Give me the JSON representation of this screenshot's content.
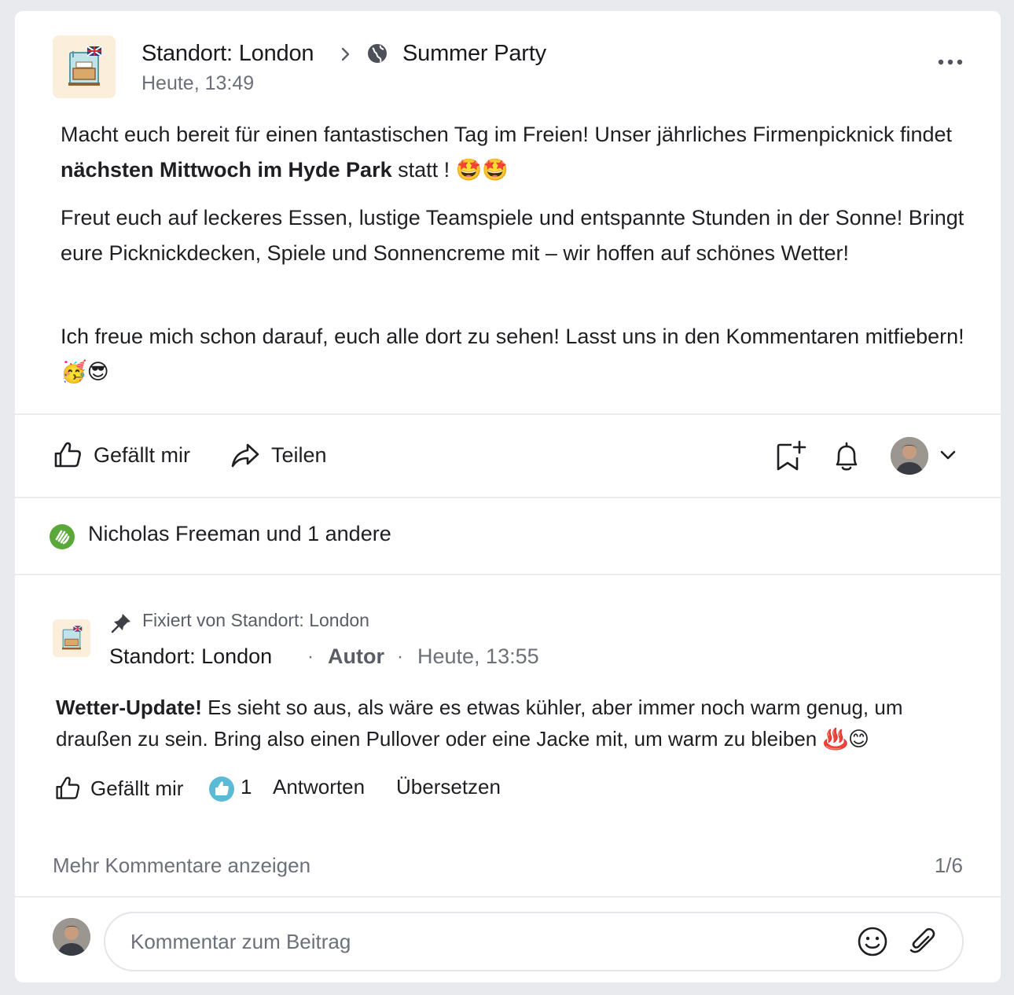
{
  "post": {
    "source": "Standort: London",
    "separator_icon": "chevron-right-icon",
    "space_icon": "globe-icon",
    "space": "Summer Party",
    "time": "Heute, 13:49",
    "more_icon": "more-horizontal-icon",
    "paragraphs": [
      {
        "pre": "Macht euch bereit für einen fantastischen Tag im Freien! Unser jährliches Firmenpicknick findet ",
        "bold": "nächsten Mittwoch im Hyde Park",
        "post": " statt ! 🤩🤩"
      },
      {
        "pre": "Freut euch auf leckeres Essen, lustige Teamspiele und entspannte Stunden in der Sonne! Bringt eure Picknickdecken, Spiele und Sonnencreme mit – wir hoffen auf schönes Wetter!",
        "bold": "",
        "post": ""
      },
      {
        "pre": "Ich freue mich schon darauf, euch alle dort zu sehen! Lasst uns in den Kommentaren mitfiebern! 🥳😎",
        "bold": "",
        "post": ""
      }
    ]
  },
  "actions": {
    "like": "Gefällt mir",
    "share": "Teilen"
  },
  "reactions": {
    "text": "Nicholas Freeman und 1 andere",
    "icon": "clap-reaction-icon",
    "color": "#5aa83a"
  },
  "comment": {
    "pinned_text": "Fixiert von Standort: London",
    "author": "Standort: London",
    "role": "Autor",
    "time": "Heute, 13:55",
    "bold": "Wetter-Update!",
    "text": " Es sieht so aus, als wäre es etwas kühler, aber immer noch warm genug, um draußen zu sein. Bring also einen Pullover oder eine Jacke mit, um warm zu bleiben ♨️😊",
    "like": "Gefällt mir",
    "like_count": "1",
    "reply": "Antworten",
    "translate": "Übersetzen"
  },
  "more_comments": {
    "label": "Mehr Kommentare anzeigen",
    "pager": "1/6"
  },
  "composer": {
    "placeholder": "Kommentar zum Beitrag"
  },
  "colors": {
    "like_badge": "#5bbad5",
    "text": "#1f1f23",
    "muted": "#6d7079"
  }
}
